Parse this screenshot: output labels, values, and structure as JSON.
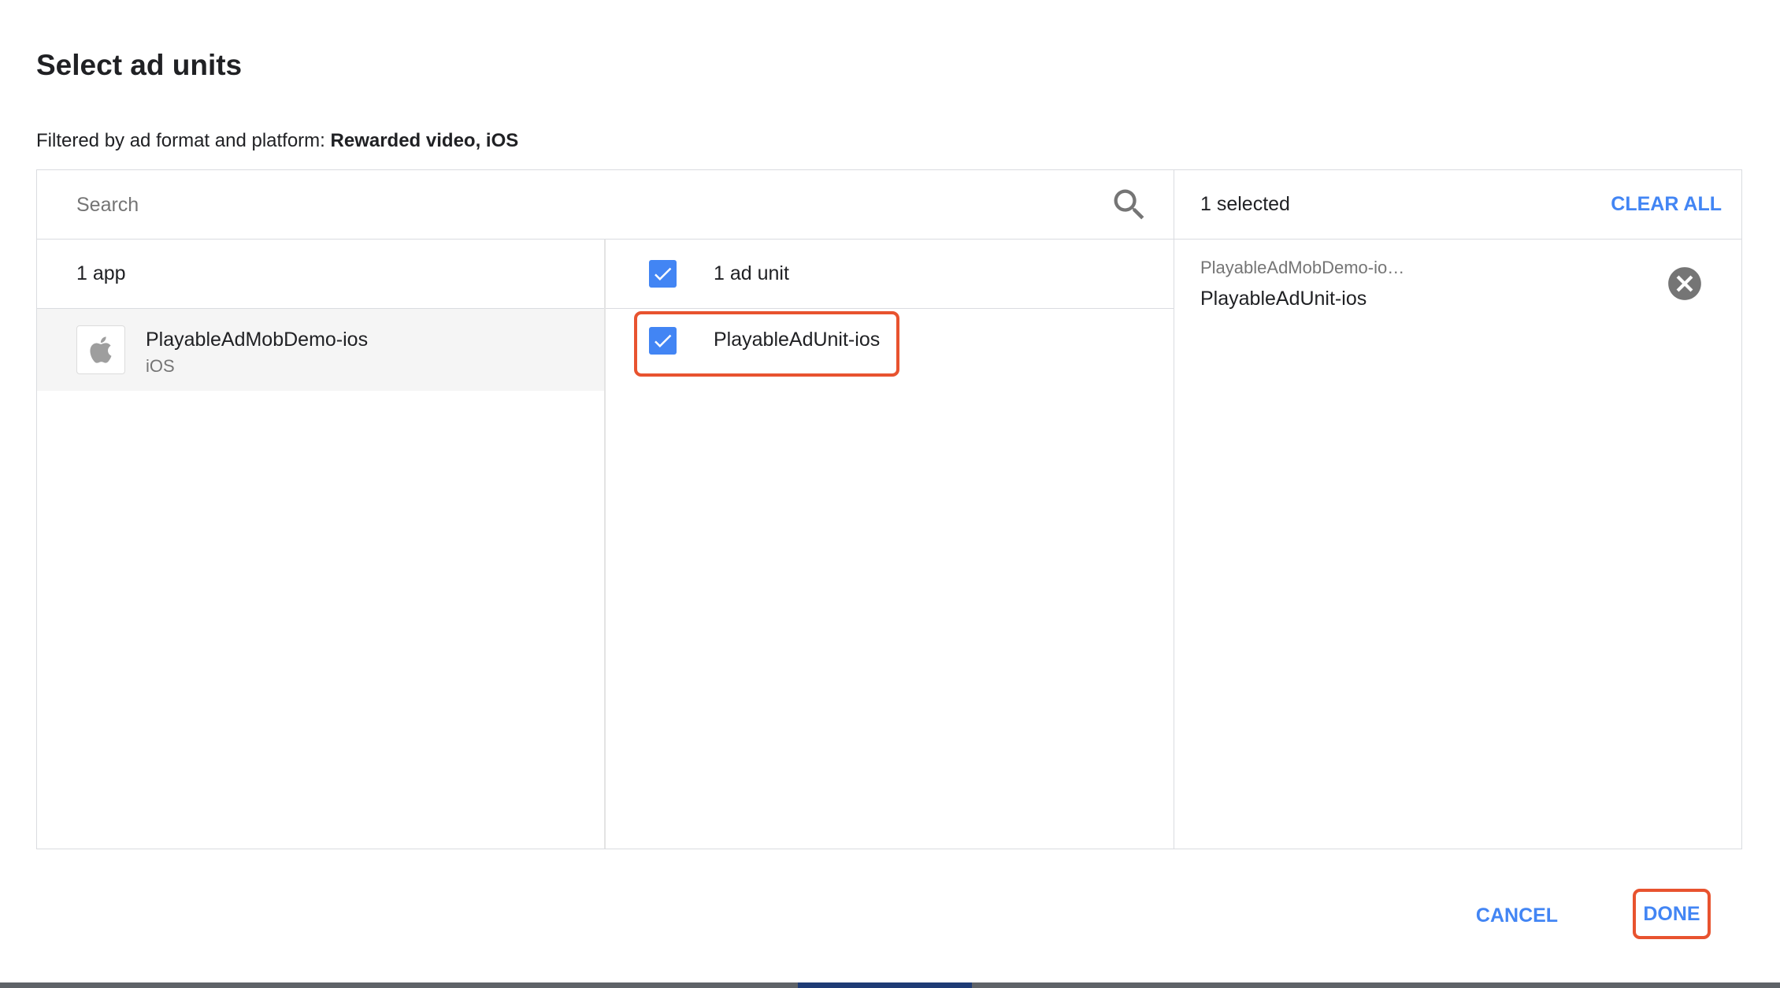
{
  "dialog": {
    "title": "Select ad units",
    "filter_prefix": "Filtered by ad format and platform:",
    "filter_value": "Rewarded video, iOS"
  },
  "search": {
    "placeholder": "Search",
    "icon": "search-icon"
  },
  "apps_column": {
    "header": "1 app",
    "items": [
      {
        "name": "PlayableAdMobDemo-ios",
        "platform": "iOS",
        "icon": "apple-icon",
        "active": true
      }
    ]
  },
  "ad_units_column": {
    "header": "1 ad unit",
    "select_all_checked": true,
    "items": [
      {
        "name": "PlayableAdUnit-ios",
        "checked": true,
        "highlighted": true
      }
    ]
  },
  "selected_panel": {
    "count_label": "1 selected",
    "clear_all_label": "CLEAR ALL",
    "items": [
      {
        "app": "PlayableAdMobDemo-io…",
        "ad_unit": "PlayableAdUnit-ios",
        "remove_icon": "close-circle-icon"
      }
    ]
  },
  "footer": {
    "cancel_label": "CANCEL",
    "done_label": "DONE",
    "done_highlighted": true
  },
  "colors": {
    "accent": "#4285f4",
    "highlight": "#e8532f",
    "text": "#202124",
    "muted": "#757575",
    "border": "#dadce0",
    "active_row": "#f5f5f5"
  }
}
